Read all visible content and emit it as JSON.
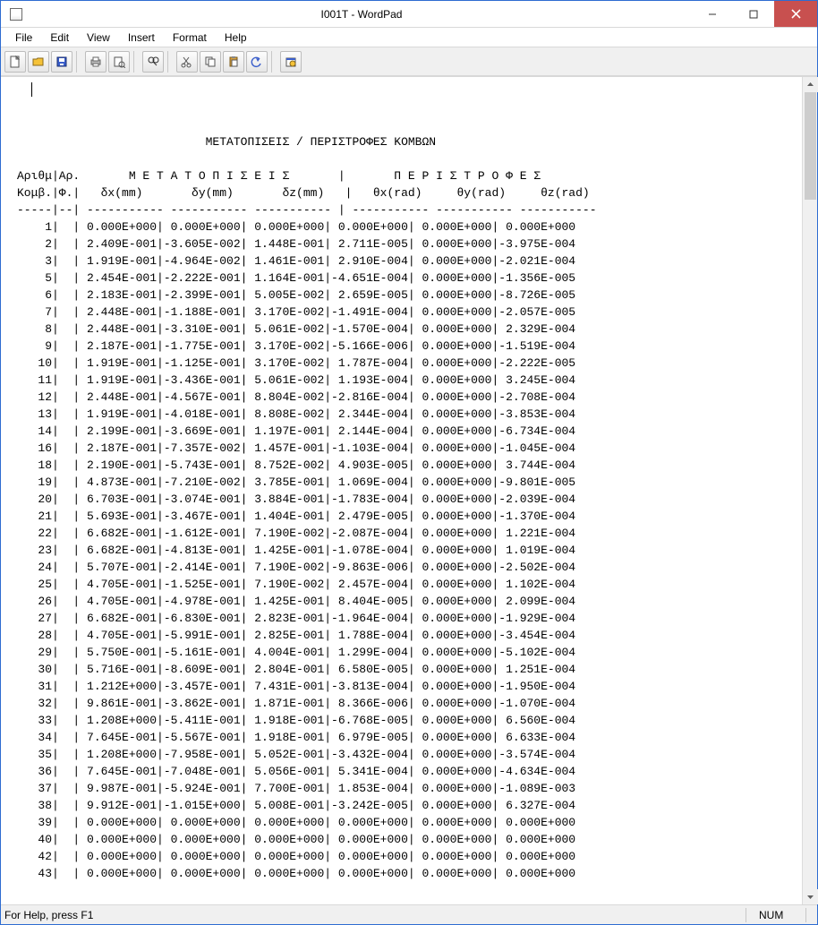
{
  "window": {
    "title": "I001T - WordPad"
  },
  "menu": {
    "file": "File",
    "edit": "Edit",
    "view": "View",
    "insert": "Insert",
    "format": "Format",
    "help": "Help"
  },
  "status": {
    "help": "For Help, press F1",
    "num": "NUM"
  },
  "doc": {
    "header_title": "ΜΕΤΑΤΟΠΙΣΕΙΣ / ΠΕΡΙΣΤΡΟΦΕΣ ΚΟΜΒΩΝ",
    "header_line1": "Αριθμ|Αρ.       Μ Ε Τ Α Τ Ο Π Ι Σ Ε Ι Σ       |       Π Ε Ρ Ι Σ Τ Ρ Ο Φ Ε Σ",
    "header_line2": "Κομβ.|Φ.|   δx(mm)       δy(mm)       δz(mm)   |   θx(rad)     θy(rad)     θz(rad)",
    "header_sep": "-----|--| ----------- ----------- ----------- | ----------- ----------- -----------",
    "rows": [
      {
        "n": 1,
        "dx": " 0.000E+000",
        "dy": " 0.000E+000",
        "dz": " 0.000E+000",
        "tx": " 0.000E+000",
        "ty": " 0.000E+000",
        "tz": " 0.000E+000"
      },
      {
        "n": 2,
        "dx": " 2.409E-001",
        "dy": "-3.605E-002",
        "dz": " 1.448E-001",
        "tx": " 2.711E-005",
        "ty": " 0.000E+000",
        "tz": "-3.975E-004"
      },
      {
        "n": 3,
        "dx": " 1.919E-001",
        "dy": "-4.964E-002",
        "dz": " 1.461E-001",
        "tx": " 2.910E-004",
        "ty": " 0.000E+000",
        "tz": "-2.021E-004"
      },
      {
        "n": 5,
        "dx": " 2.454E-001",
        "dy": "-2.222E-001",
        "dz": " 1.164E-001",
        "tx": "-4.651E-004",
        "ty": " 0.000E+000",
        "tz": "-1.356E-005"
      },
      {
        "n": 6,
        "dx": " 2.183E-001",
        "dy": "-2.399E-001",
        "dz": " 5.005E-002",
        "tx": " 2.659E-005",
        "ty": " 0.000E+000",
        "tz": "-8.726E-005"
      },
      {
        "n": 7,
        "dx": " 2.448E-001",
        "dy": "-1.188E-001",
        "dz": " 3.170E-002",
        "tx": "-1.491E-004",
        "ty": " 0.000E+000",
        "tz": "-2.057E-005"
      },
      {
        "n": 8,
        "dx": " 2.448E-001",
        "dy": "-3.310E-001",
        "dz": " 5.061E-002",
        "tx": "-1.570E-004",
        "ty": " 0.000E+000",
        "tz": " 2.329E-004"
      },
      {
        "n": 9,
        "dx": " 2.187E-001",
        "dy": "-1.775E-001",
        "dz": " 3.170E-002",
        "tx": "-5.166E-006",
        "ty": " 0.000E+000",
        "tz": "-1.519E-004"
      },
      {
        "n": 10,
        "dx": " 1.919E-001",
        "dy": "-1.125E-001",
        "dz": " 3.170E-002",
        "tx": " 1.787E-004",
        "ty": " 0.000E+000",
        "tz": "-2.222E-005"
      },
      {
        "n": 11,
        "dx": " 1.919E-001",
        "dy": "-3.436E-001",
        "dz": " 5.061E-002",
        "tx": " 1.193E-004",
        "ty": " 0.000E+000",
        "tz": " 3.245E-004"
      },
      {
        "n": 12,
        "dx": " 2.448E-001",
        "dy": "-4.567E-001",
        "dz": " 8.804E-002",
        "tx": "-2.816E-004",
        "ty": " 0.000E+000",
        "tz": "-2.708E-004"
      },
      {
        "n": 13,
        "dx": " 1.919E-001",
        "dy": "-4.018E-001",
        "dz": " 8.808E-002",
        "tx": " 2.344E-004",
        "ty": " 0.000E+000",
        "tz": "-3.853E-004"
      },
      {
        "n": 14,
        "dx": " 2.199E-001",
        "dy": "-3.669E-001",
        "dz": " 1.197E-001",
        "tx": " 2.144E-004",
        "ty": " 0.000E+000",
        "tz": "-6.734E-004"
      },
      {
        "n": 16,
        "dx": " 2.187E-001",
        "dy": "-7.357E-002",
        "dz": " 1.457E-001",
        "tx": "-1.103E-004",
        "ty": " 0.000E+000",
        "tz": "-1.045E-004"
      },
      {
        "n": 18,
        "dx": " 2.190E-001",
        "dy": "-5.743E-001",
        "dz": " 8.752E-002",
        "tx": " 4.903E-005",
        "ty": " 0.000E+000",
        "tz": " 3.744E-004"
      },
      {
        "n": 19,
        "dx": " 4.873E-001",
        "dy": "-7.210E-002",
        "dz": " 3.785E-001",
        "tx": " 1.069E-004",
        "ty": " 0.000E+000",
        "tz": "-9.801E-005"
      },
      {
        "n": 20,
        "dx": " 6.703E-001",
        "dy": "-3.074E-001",
        "dz": " 3.884E-001",
        "tx": "-1.783E-004",
        "ty": " 0.000E+000",
        "tz": "-2.039E-004"
      },
      {
        "n": 21,
        "dx": " 5.693E-001",
        "dy": "-3.467E-001",
        "dz": " 1.404E-001",
        "tx": " 2.479E-005",
        "ty": " 0.000E+000",
        "tz": "-1.370E-004"
      },
      {
        "n": 22,
        "dx": " 6.682E-001",
        "dy": "-1.612E-001",
        "dz": " 7.190E-002",
        "tx": "-2.087E-004",
        "ty": " 0.000E+000",
        "tz": " 1.221E-004"
      },
      {
        "n": 23,
        "dx": " 6.682E-001",
        "dy": "-4.813E-001",
        "dz": " 1.425E-001",
        "tx": "-1.078E-004",
        "ty": " 0.000E+000",
        "tz": " 1.019E-004"
      },
      {
        "n": 24,
        "dx": " 5.707E-001",
        "dy": "-2.414E-001",
        "dz": " 7.190E-002",
        "tx": "-9.863E-006",
        "ty": " 0.000E+000",
        "tz": "-2.502E-004"
      },
      {
        "n": 25,
        "dx": " 4.705E-001",
        "dy": "-1.525E-001",
        "dz": " 7.190E-002",
        "tx": " 2.457E-004",
        "ty": " 0.000E+000",
        "tz": " 1.102E-004"
      },
      {
        "n": 26,
        "dx": " 4.705E-001",
        "dy": "-4.978E-001",
        "dz": " 1.425E-001",
        "tx": " 8.404E-005",
        "ty": " 0.000E+000",
        "tz": " 2.099E-004"
      },
      {
        "n": 27,
        "dx": " 6.682E-001",
        "dy": "-6.830E-001",
        "dz": " 2.823E-001",
        "tx": "-1.964E-004",
        "ty": " 0.000E+000",
        "tz": "-1.929E-004"
      },
      {
        "n": 28,
        "dx": " 4.705E-001",
        "dy": "-5.991E-001",
        "dz": " 2.825E-001",
        "tx": " 1.788E-004",
        "ty": " 0.000E+000",
        "tz": "-3.454E-004"
      },
      {
        "n": 29,
        "dx": " 5.750E-001",
        "dy": "-5.161E-001",
        "dz": " 4.004E-001",
        "tx": " 1.299E-004",
        "ty": " 0.000E+000",
        "tz": "-5.102E-004"
      },
      {
        "n": 30,
        "dx": " 5.716E-001",
        "dy": "-8.609E-001",
        "dz": " 2.804E-001",
        "tx": " 6.580E-005",
        "ty": " 0.000E+000",
        "tz": " 1.251E-004"
      },
      {
        "n": 31,
        "dx": " 1.212E+000",
        "dy": "-3.457E-001",
        "dz": " 7.431E-001",
        "tx": "-3.813E-004",
        "ty": " 0.000E+000",
        "tz": "-1.950E-004"
      },
      {
        "n": 32,
        "dx": " 9.861E-001",
        "dy": "-3.862E-001",
        "dz": " 1.871E-001",
        "tx": " 8.366E-006",
        "ty": " 0.000E+000",
        "tz": "-1.070E-004"
      },
      {
        "n": 33,
        "dx": " 1.208E+000",
        "dy": "-5.411E-001",
        "dz": " 1.918E-001",
        "tx": "-6.768E-005",
        "ty": " 0.000E+000",
        "tz": " 6.560E-004"
      },
      {
        "n": 34,
        "dx": " 7.645E-001",
        "dy": "-5.567E-001",
        "dz": " 1.918E-001",
        "tx": " 6.979E-005",
        "ty": " 0.000E+000",
        "tz": " 6.633E-004"
      },
      {
        "n": 35,
        "dx": " 1.208E+000",
        "dy": "-7.958E-001",
        "dz": " 5.052E-001",
        "tx": "-3.432E-004",
        "ty": " 0.000E+000",
        "tz": "-3.574E-004"
      },
      {
        "n": 36,
        "dx": " 7.645E-001",
        "dy": "-7.048E-001",
        "dz": " 5.056E-001",
        "tx": " 5.341E-004",
        "ty": " 0.000E+000",
        "tz": "-4.634E-004"
      },
      {
        "n": 37,
        "dx": " 9.987E-001",
        "dy": "-5.924E-001",
        "dz": " 7.700E-001",
        "tx": " 1.853E-004",
        "ty": " 0.000E+000",
        "tz": "-1.089E-003"
      },
      {
        "n": 38,
        "dx": " 9.912E-001",
        "dy": "-1.015E+000",
        "dz": " 5.008E-001",
        "tx": "-3.242E-005",
        "ty": " 0.000E+000",
        "tz": " 6.327E-004"
      },
      {
        "n": 39,
        "dx": " 0.000E+000",
        "dy": " 0.000E+000",
        "dz": " 0.000E+000",
        "tx": " 0.000E+000",
        "ty": " 0.000E+000",
        "tz": " 0.000E+000"
      },
      {
        "n": 40,
        "dx": " 0.000E+000",
        "dy": " 0.000E+000",
        "dz": " 0.000E+000",
        "tx": " 0.000E+000",
        "ty": " 0.000E+000",
        "tz": " 0.000E+000"
      },
      {
        "n": 42,
        "dx": " 0.000E+000",
        "dy": " 0.000E+000",
        "dz": " 0.000E+000",
        "tx": " 0.000E+000",
        "ty": " 0.000E+000",
        "tz": " 0.000E+000"
      },
      {
        "n": 43,
        "dx": " 0.000E+000",
        "dy": " 0.000E+000",
        "dz": " 0.000E+000",
        "tx": " 0.000E+000",
        "ty": " 0.000E+000",
        "tz": " 0.000E+000"
      }
    ]
  }
}
